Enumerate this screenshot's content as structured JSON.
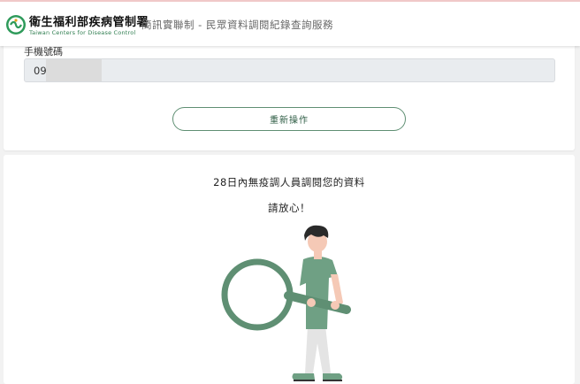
{
  "header": {
    "brand_name": "衛生福利部疾病管制署",
    "brand_subtitle": "Taiwan Centers for Disease Control",
    "page_title": "簡訊實聯制 - 民眾資料調閱紀錄查詢服務"
  },
  "form": {
    "phone_label": "手機號碼",
    "phone_value": "09",
    "reset_label": "重新操作"
  },
  "result": {
    "message": "28日內無疫調人員調閱您的資料",
    "reassure": "請放心！"
  },
  "colors": {
    "accent_green": "#5f8f73",
    "logo_green": "#2e9a5a",
    "shirt_green": "#6fa084"
  },
  "icons": {
    "logo": "cdc-logo-icon",
    "illustration": "magnifying-glass-person-illustration"
  }
}
